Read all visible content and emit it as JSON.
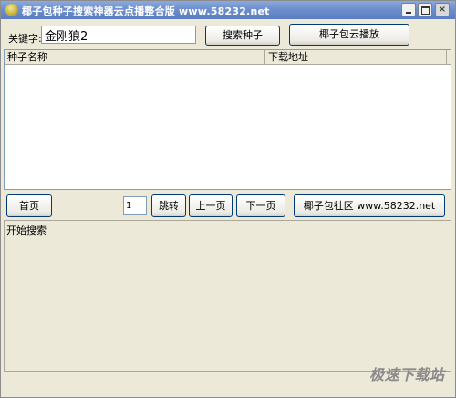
{
  "window": {
    "title": "椰子包种子搜索神器云点播整合版 www.58232.net",
    "minimize_label": "",
    "maximize_label": "",
    "close_label": "×"
  },
  "search": {
    "keyword_label": "关键字:",
    "keyword_value": "金刚狼2",
    "search_button": "搜索种子",
    "cloud_play_button": "椰子包云播放"
  },
  "results_table": {
    "columns": [
      "种子名称",
      "下载地址"
    ],
    "rows": []
  },
  "pager": {
    "first_page": "首页",
    "page_number": "1",
    "jump": "跳转",
    "prev_page": "上一页",
    "next_page": "下一页",
    "community": "椰子包社区 www.58232.net"
  },
  "log": {
    "status_text": "开始搜索"
  },
  "watermark": {
    "text": "极速下载站"
  },
  "colors": {
    "title_bar": "#6e8fcd",
    "window_bg": "#ece9d8",
    "button_border": "#003c74"
  }
}
